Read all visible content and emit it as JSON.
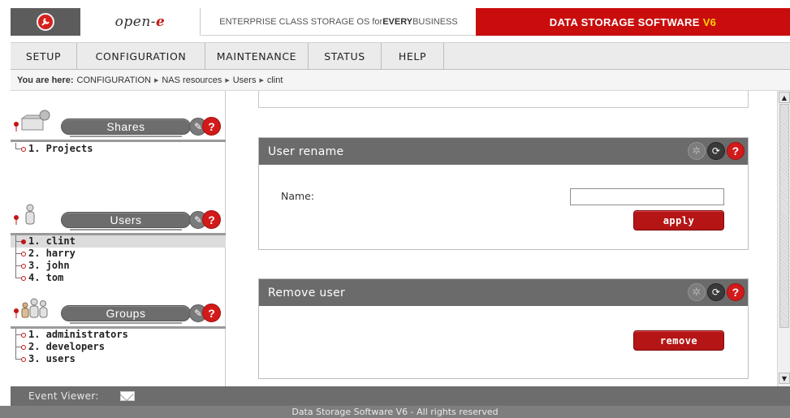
{
  "header": {
    "brand": "open-",
    "brand_accent": "e",
    "slogan_prefix": "ENTERPRISE CLASS STORAGE OS for ",
    "slogan_bold": "EVERY",
    "slogan_suffix": " BUSINESS",
    "product": "DATA STORAGE SOFTWARE",
    "product_version": "V6",
    "accent_color": "#c90d0d"
  },
  "menu": [
    "SETUP",
    "CONFIGURATION",
    "MAINTENANCE",
    "STATUS",
    "HELP"
  ],
  "breadcrumb": {
    "label": "You are here:",
    "items": [
      "CONFIGURATION",
      "NAS resources",
      "Users",
      "clint"
    ]
  },
  "sidebar": {
    "shares": {
      "title": "Shares",
      "items": [
        "1. Projects"
      ]
    },
    "users": {
      "title": "Users",
      "items": [
        "1. clint",
        "2. harry",
        "3. john",
        "4. tom"
      ],
      "selected_index": 0
    },
    "groups": {
      "title": "Groups",
      "items": [
        "1. administrators",
        "2. developers",
        "3. users"
      ]
    }
  },
  "main": {
    "rename": {
      "title": "User rename",
      "name_label": "Name:",
      "name_value": "",
      "apply_label": "apply"
    },
    "remove": {
      "title": "Remove user",
      "remove_label": "remove"
    }
  },
  "footer": {
    "event_viewer": "Event Viewer:",
    "copyright": "Data Storage Software V6 - All rights reserved"
  }
}
